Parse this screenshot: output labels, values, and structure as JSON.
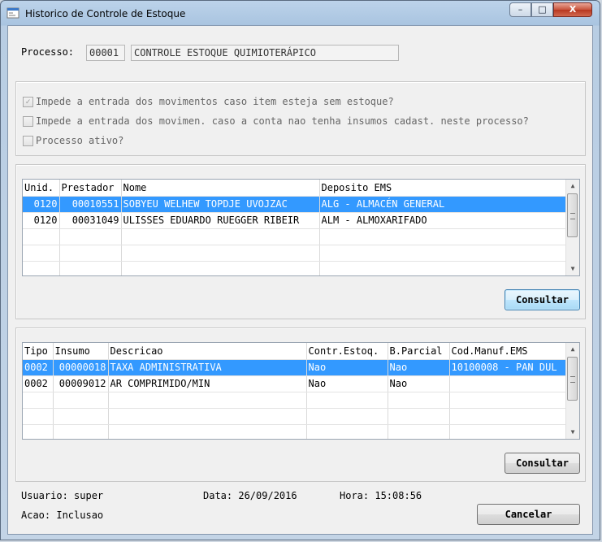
{
  "window": {
    "title": "Historico de Controle de Estoque",
    "buttons": {
      "minimize": "–",
      "maximize": "□",
      "close": "X"
    }
  },
  "processo": {
    "label": "Processo:",
    "code": "00001",
    "description": "CONTROLE ESTOQUE QUIMIOTERÁPICO"
  },
  "options": [
    {
      "label": "Impede a entrada dos movimentos caso item esteja sem estoque?",
      "checked": true
    },
    {
      "label": "Impede a entrada dos movimen. caso a conta nao tenha insumos cadast. neste processo?",
      "checked": false
    },
    {
      "label": "Processo ativo?",
      "checked": false
    }
  ],
  "grid1": {
    "columns": [
      "Unid.",
      "Prestador",
      "Nome",
      "Deposito EMS"
    ],
    "rows": [
      [
        "0120",
        "00010551",
        "SOBYEU WELHEW TOPDJE UVOJZAC",
        "ALG - ALMACÉN GENERAL"
      ],
      [
        "0120",
        "00031049",
        "ULISSES EDUARDO RUEGGER RIBEIR",
        "ALM - ALMOXARIFADO"
      ]
    ],
    "selected_row": 0,
    "button": "Consultar"
  },
  "grid2": {
    "columns": [
      "Tipo",
      "Insumo",
      "Descricao",
      "Contr.Estoq.",
      "B.Parcial",
      "Cod.Manuf.EMS"
    ],
    "rows": [
      [
        "0002",
        "00000018",
        "TAXA ADMINISTRATIVA",
        "Nao",
        "Nao",
        "10100008 - PAN DUL"
      ],
      [
        "0002",
        "00009012",
        "AR COMPRIMIDO/MIN",
        "Nao",
        "Nao",
        ""
      ]
    ],
    "selected_row": 0,
    "button": "Consultar"
  },
  "footer": {
    "usuario": "Usuario: super",
    "data": "Data: 26/09/2016",
    "hora": "Hora: 15:08:56",
    "acao": "Acao: Inclusao",
    "cancel": "Cancelar"
  },
  "colors": {
    "selection": "#3399ff",
    "focus_border": "#3c7fb1"
  }
}
